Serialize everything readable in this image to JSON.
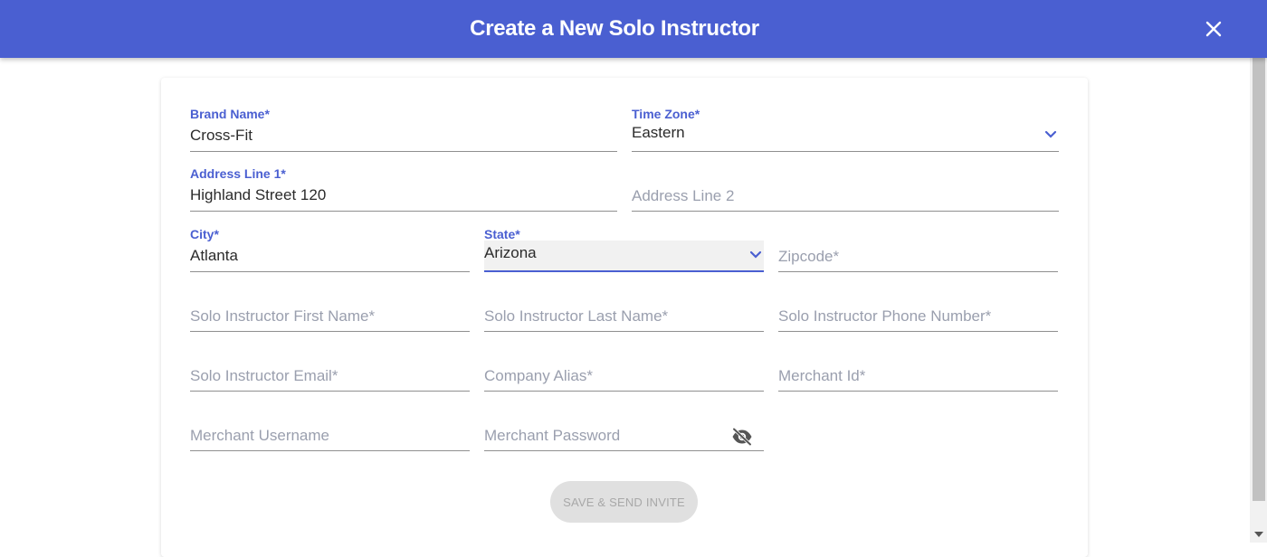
{
  "header": {
    "title": "Create a New Solo Instructor"
  },
  "form": {
    "brand_name": {
      "label": "Brand Name*",
      "value": "Cross-Fit"
    },
    "time_zone": {
      "label": "Time Zone*",
      "value": "Eastern"
    },
    "address_line_1": {
      "label": "Address Line 1*",
      "value": "Highland Street 120"
    },
    "address_line_2": {
      "placeholder": "Address Line 2"
    },
    "city": {
      "label": "City*",
      "value": "Atlanta"
    },
    "state": {
      "label": "State*",
      "value": "Arizona"
    },
    "zipcode": {
      "placeholder": "Zipcode*"
    },
    "first_name": {
      "placeholder": "Solo Instructor First Name*"
    },
    "last_name": {
      "placeholder": "Solo Instructor Last Name*"
    },
    "phone": {
      "placeholder": "Solo Instructor Phone Number*"
    },
    "email": {
      "placeholder": "Solo Instructor Email*"
    },
    "company_alias": {
      "placeholder": "Company Alias*"
    },
    "merchant_id": {
      "placeholder": "Merchant Id*"
    },
    "merchant_username": {
      "placeholder": "Merchant Username"
    },
    "merchant_password": {
      "placeholder": "Merchant Password"
    },
    "submit_label": "SAVE & SEND INVITE"
  },
  "colors": {
    "accent": "#4a5fd1",
    "disabled_bg": "#e0e0e0",
    "disabled_text": "#a8a8a8"
  },
  "icons": {
    "close": "close-icon",
    "chevron": "chevron-down-icon",
    "visibility_off": "eye-off-icon"
  }
}
